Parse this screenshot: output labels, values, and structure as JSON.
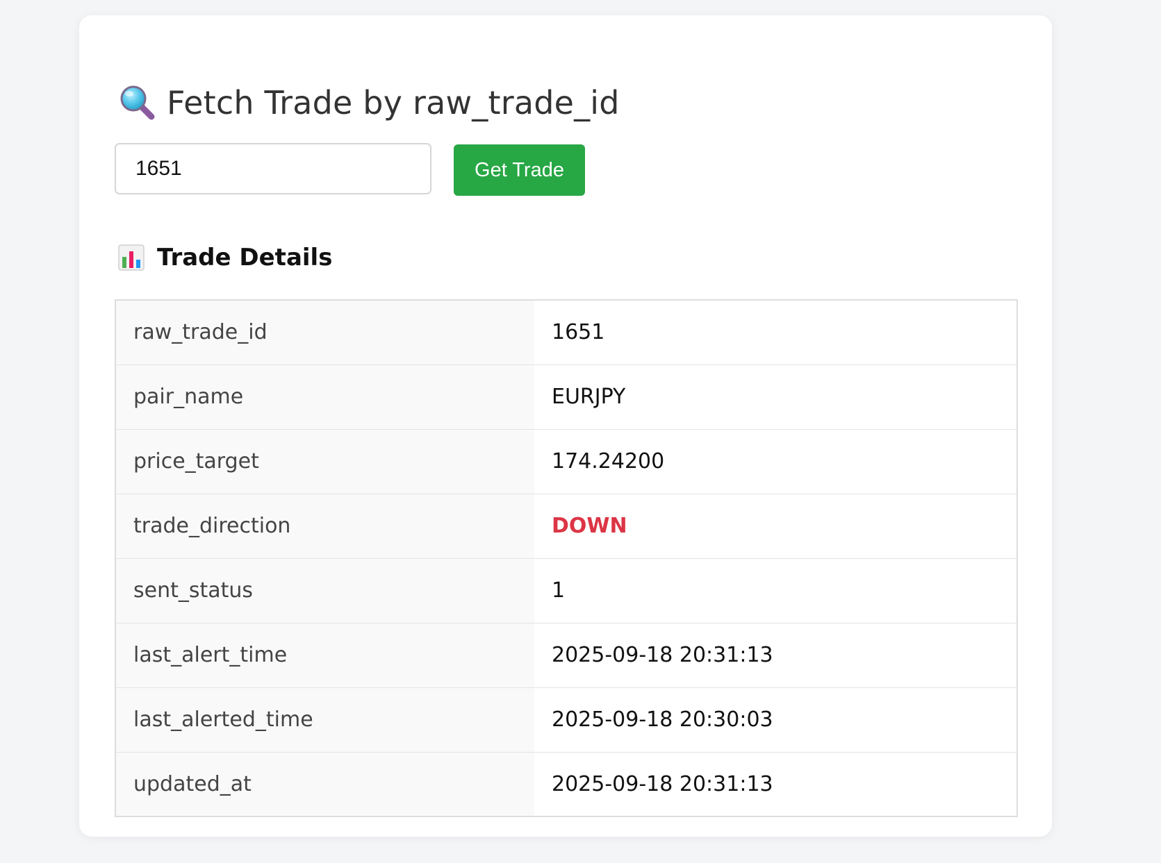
{
  "page": {
    "title": "Fetch Trade by raw_trade_id",
    "title_icon": "magnifying-glass-icon"
  },
  "search": {
    "value": "1651",
    "button_label": "Get Trade",
    "button_color": "#28a745"
  },
  "details": {
    "heading": "Trade Details",
    "heading_icon": "bar-chart-icon",
    "rows": [
      {
        "key": "raw_trade_id",
        "value": "1651"
      },
      {
        "key": "pair_name",
        "value": "EURJPY"
      },
      {
        "key": "price_target",
        "value": "174.24200"
      },
      {
        "key": "trade_direction",
        "value": "DOWN",
        "value_color": "#dc3545"
      },
      {
        "key": "sent_status",
        "value": "1"
      },
      {
        "key": "last_alert_time",
        "value": "2025-09-18 20:31:13"
      },
      {
        "key": "last_alerted_time",
        "value": "2025-09-18 20:30:03"
      },
      {
        "key": "updated_at",
        "value": "2025-09-18 20:31:13"
      }
    ]
  }
}
